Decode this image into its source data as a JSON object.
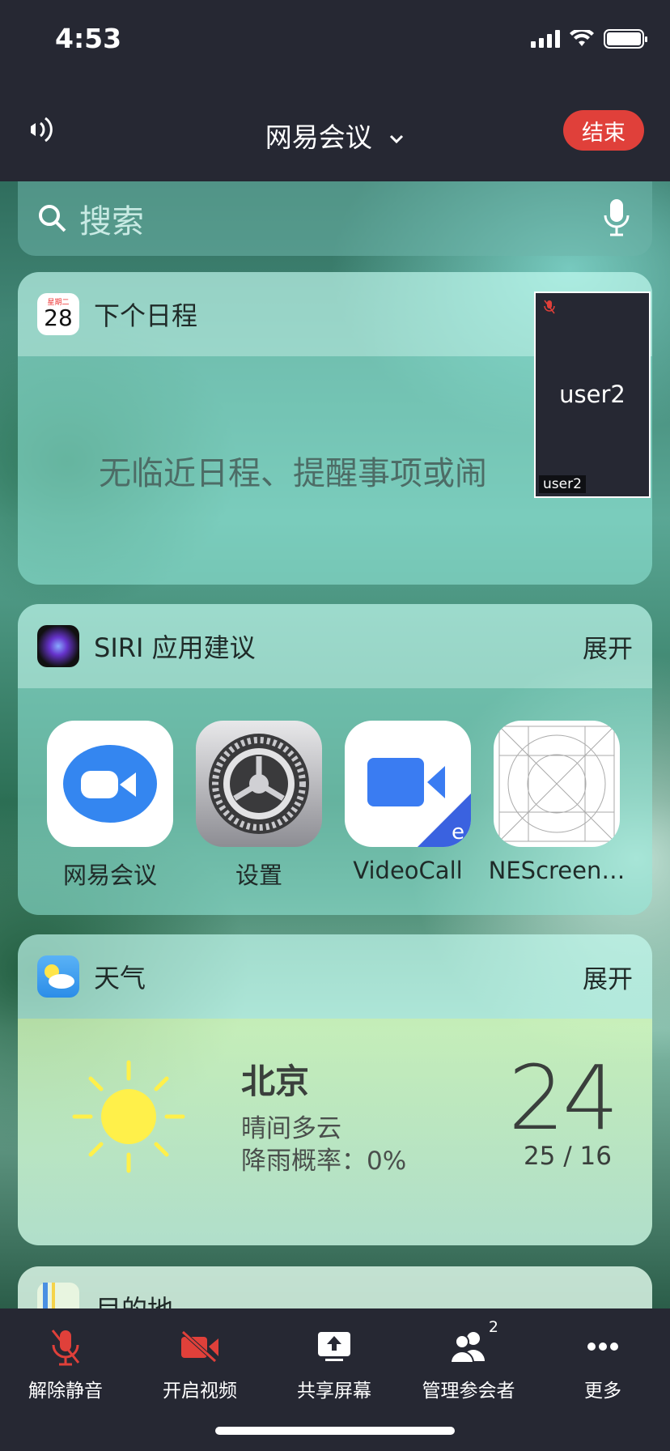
{
  "status": {
    "time": "4:53"
  },
  "header": {
    "title": "网易会议",
    "end_label": "结束"
  },
  "search": {
    "placeholder": "搜索"
  },
  "schedule_widget": {
    "title": "下个日程",
    "calendar_day": "星期二",
    "calendar_date": "28",
    "empty_text": "无临近日程、提醒事项或闹"
  },
  "user_tile": {
    "name": "user2",
    "tag": "user2"
  },
  "siri_widget": {
    "title": "SIRI 应用建议",
    "expand": "展开",
    "apps": [
      {
        "name": "网易会议",
        "icon": "meeting-app-icon"
      },
      {
        "name": "设置",
        "icon": "settings-gear-icon"
      },
      {
        "name": "VideoCall",
        "icon": "videocall-app-icon"
      },
      {
        "name": "NEScreen…",
        "icon": "placeholder-app-icon"
      }
    ]
  },
  "weather_widget": {
    "title": "天气",
    "expand": "展开",
    "city": "北京",
    "condition": "晴间多云",
    "rain": "降雨概率：0%",
    "temp": "24",
    "range": "25 / 16"
  },
  "dest_widget": {
    "title": "目的地"
  },
  "toolbar": {
    "items": [
      {
        "label": "解除静音",
        "icon": "mic-muted-icon"
      },
      {
        "label": "开启视频",
        "icon": "video-off-icon"
      },
      {
        "label": "共享屏幕",
        "icon": "share-screen-icon"
      },
      {
        "label": "管理参会者",
        "icon": "participants-icon",
        "badge": "2"
      },
      {
        "label": "更多",
        "icon": "more-icon"
      }
    ]
  },
  "colors": {
    "end_red": "#e0403a",
    "bar_dark": "#262833",
    "muted_red": "#e0403a"
  }
}
